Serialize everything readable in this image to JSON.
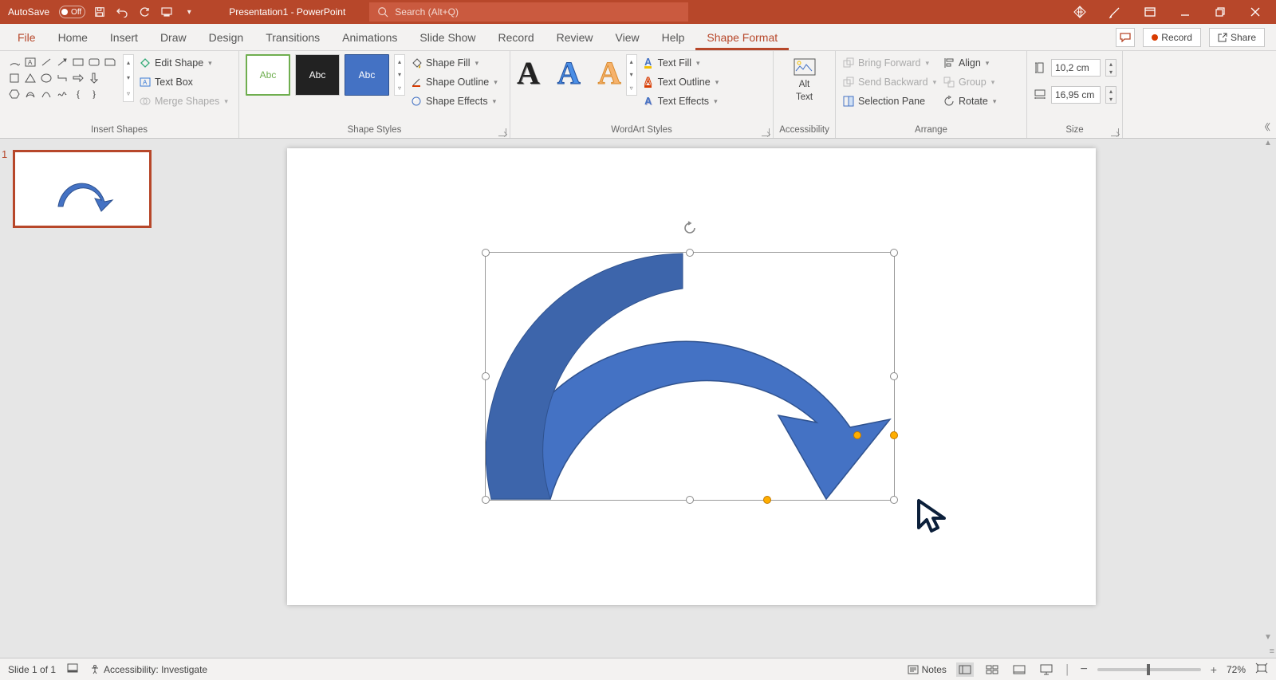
{
  "titlebar": {
    "autosave_label": "AutoSave",
    "autosave_state": "Off",
    "title": "Presentation1 - PowerPoint",
    "search_placeholder": "Search (Alt+Q)"
  },
  "tabs": {
    "file": "File",
    "home": "Home",
    "insert": "Insert",
    "draw": "Draw",
    "design": "Design",
    "transitions": "Transitions",
    "animations": "Animations",
    "slideshow": "Slide Show",
    "record": "Record",
    "review": "Review",
    "view": "View",
    "help": "Help",
    "shapeformat": "Shape Format",
    "record_btn": "Record",
    "share_btn": "Share"
  },
  "ribbon": {
    "insert_shapes": {
      "label": "Insert Shapes",
      "edit_shape": "Edit Shape",
      "text_box": "Text Box",
      "merge_shapes": "Merge Shapes"
    },
    "shape_styles": {
      "label": "Shape Styles",
      "abc": "Abc",
      "shape_fill": "Shape Fill",
      "shape_outline": "Shape Outline",
      "shape_effects": "Shape Effects"
    },
    "wordart": {
      "label": "WordArt Styles",
      "text_fill": "Text Fill",
      "text_outline": "Text Outline",
      "text_effects": "Text Effects"
    },
    "accessibility": {
      "label": "Accessibility",
      "alt_text_1": "Alt",
      "alt_text_2": "Text"
    },
    "arrange": {
      "label": "Arrange",
      "bring_forward": "Bring Forward",
      "send_backward": "Send Backward",
      "selection_pane": "Selection Pane",
      "align": "Align",
      "group": "Group",
      "rotate": "Rotate"
    },
    "size": {
      "label": "Size",
      "height": "10,2 cm",
      "width": "16,95 cm"
    }
  },
  "thumbs": {
    "num": "1"
  },
  "status": {
    "slide": "Slide 1 of 1",
    "accessibility": "Accessibility: Investigate",
    "notes": "Notes",
    "zoom": "72%"
  }
}
